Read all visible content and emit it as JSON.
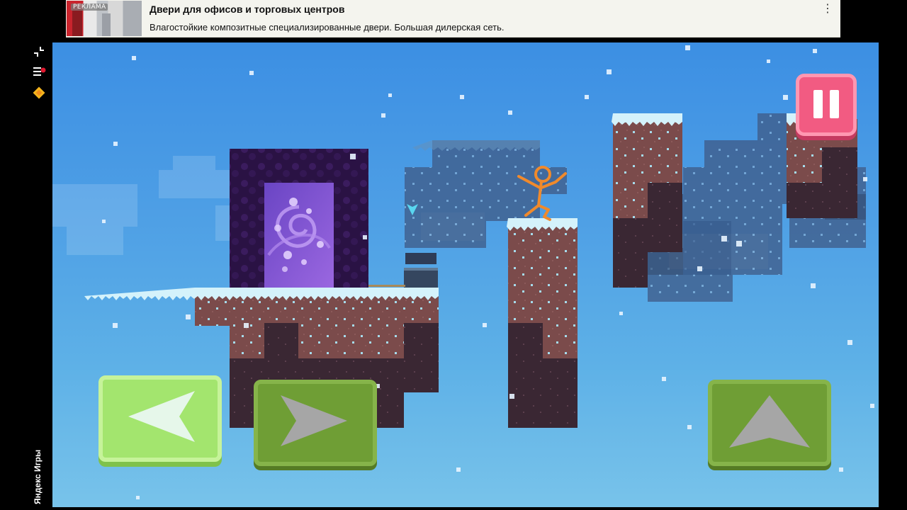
{
  "ad": {
    "tag": "РЕКЛАМА",
    "title": "Двери для офисов и торговых центров",
    "description": "Влагостойкие композитные специализированные двери. Большая дилерская сеть.",
    "more_icon": "⋮"
  },
  "platform": {
    "label": "Яндекс Игры",
    "icons": [
      "collapse-icon",
      "menu-icon",
      "yandex-games-icon"
    ]
  },
  "game": {
    "pause_icon": "pause-icon",
    "controls": {
      "left_icon": "arrow-left-icon",
      "right_icon": "arrow-right-icon",
      "jump_icon": "arrow-up-icon"
    },
    "colors": {
      "sky_top": "#3c8fe3",
      "sky_bottom": "#78c3ea",
      "dirt": "#7b4b4b",
      "dirt_dark": "#3a2733",
      "snow": "#cdeef8",
      "portal_frame": "#2a1244",
      "portal_swirl": "#8e5bd3",
      "stickman": "#f08a2c",
      "pause_button": "#f25b82",
      "button_active": "#a3e56e",
      "button_idle": "#6f9e35"
    }
  }
}
